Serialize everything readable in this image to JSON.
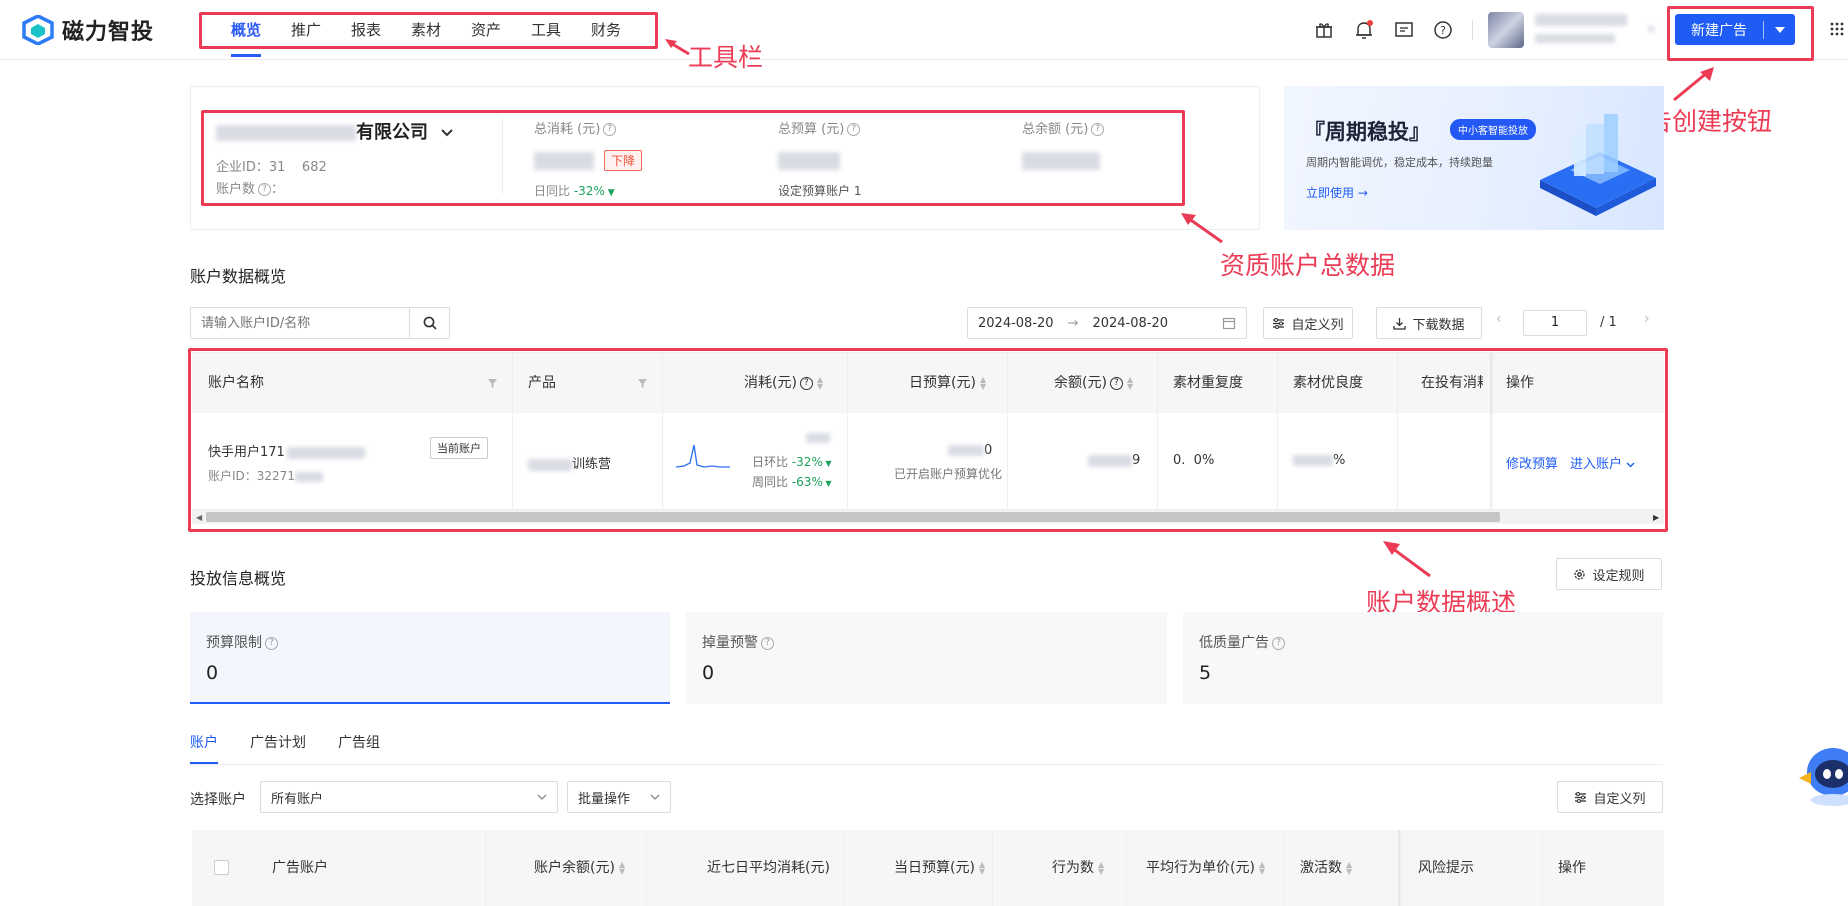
{
  "brand": {
    "name": "磁力智投"
  },
  "nav": {
    "items": [
      "概览",
      "推广",
      "报表",
      "素材",
      "资产",
      "工具",
      "财务"
    ]
  },
  "annotations": {
    "toolbar": "工具栏",
    "create_button": "广告创建按钮",
    "qual_summary": "资质账户总数据",
    "account_summary": "账户数据概述"
  },
  "header": {
    "new_ad_label": "新建广告"
  },
  "company": {
    "name_suffix": "有限公司",
    "enterprise_id_label": "企业ID：",
    "enterprise_id": "31    682",
    "account_count_label": "账户数",
    "account_count_value": "："
  },
  "stats": {
    "total_spend": "总消耗 (元)",
    "total_budget": "总预算 (元)",
    "total_balance": "总余额 (元)",
    "down_tag": "下降",
    "dod_label": "日同比",
    "dod_value": "-32%",
    "budget_accounts": "设定预算账户 1"
  },
  "banner": {
    "title": "『周期稳投』",
    "badge": "中小客智能投放",
    "desc": "周期内智能调优，稳定成本，持续跑量",
    "cta": "立即使用 →"
  },
  "account_overview": {
    "title": "账户数据概览",
    "search_placeholder": "请输入账户ID/名称",
    "date_start": "2024-08-20",
    "date_end": "2024-08-20",
    "custom_cols": "自定义列",
    "download": "下载数据",
    "page": "1",
    "total_pages": "/ 1",
    "columns": [
      "账户名称",
      "产品",
      "消耗(元)",
      "日预算(元)",
      "余额(元)",
      "素材重复度",
      "素材优良度",
      "在投有消耗",
      "操作"
    ],
    "row": {
      "account_name": "快手用户171",
      "account_id": "账户ID：32271",
      "current_tag": "当前账户",
      "product_suffix": "训练营",
      "dod": "日环比",
      "dod_value": "-32%",
      "wow": "周同比",
      "wow_value": "-63%",
      "budget_tail": "0",
      "budget_note": "已开启账户预算优化",
      "balance_tail": "9",
      "repeat_value": "0.  0%",
      "quality_value": "%",
      "action_edit": "修改预算",
      "action_enter": "进入账户"
    }
  },
  "delivery": {
    "title": "投放信息概览",
    "rule_btn": "设定规则",
    "kpis": [
      {
        "label": "预算限制",
        "value": "0"
      },
      {
        "label": "掉量预警",
        "value": "0"
      },
      {
        "label": "低质量广告",
        "value": "5"
      }
    ],
    "tabs": [
      "账户",
      "广告计划",
      "广告组"
    ],
    "select_label": "选择账户",
    "select_value": "所有账户",
    "batch": "批量操作",
    "custom_cols": "自定义列",
    "columns": [
      "广告账户",
      "账户余额(元)",
      "近七日平均消耗(元)",
      "当日预算(元)",
      "行为数",
      "平均行为单价(元)",
      "激活数",
      "风险提示",
      "操作"
    ]
  }
}
